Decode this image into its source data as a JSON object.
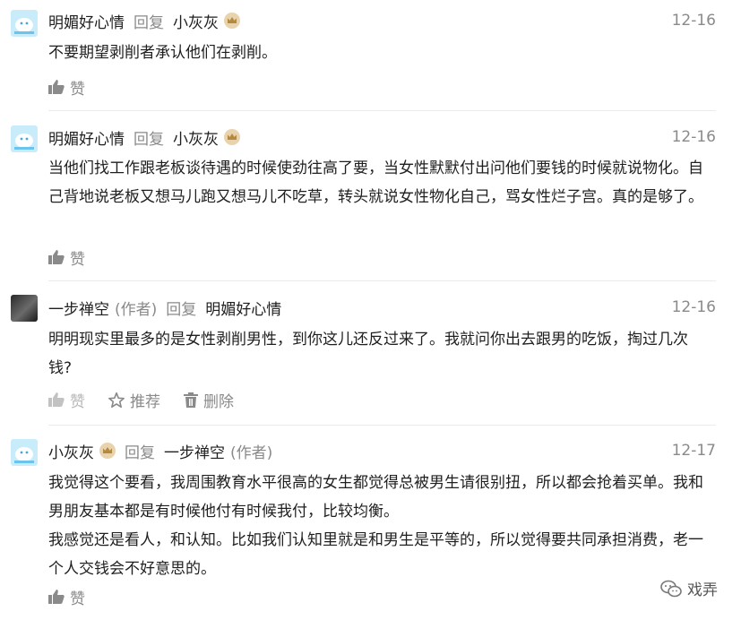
{
  "comments": [
    {
      "author": "明媚好心情",
      "author_tag": "",
      "reply_label": "回复",
      "reply_to": "小灰灰",
      "reply_to_tag": "",
      "date": "12-16",
      "text": "不要期望剥削者承认他们在剥削。",
      "actions": [
        "赞"
      ]
    },
    {
      "author": "明媚好心情",
      "author_tag": "",
      "reply_label": "回复",
      "reply_to": "小灰灰",
      "reply_to_tag": "",
      "date": "12-16",
      "text": "当他们找工作跟老板谈待遇的时候使劲往高了要，当女性默默付出问他们要钱的时候就说物化。自己背地说老板又想马儿跑又想马儿不吃草，转头就说女性物化自己，骂女性烂子宫。真的是够了。",
      "actions": [
        "赞"
      ]
    },
    {
      "author": "一步禅空",
      "author_tag": "(作者)",
      "reply_label": "回复",
      "reply_to": "明媚好心情",
      "reply_to_tag": "",
      "date": "12-16",
      "text": "明明现实里最多的是女性剥削男性，到你这儿还反过来了。我就问你出去跟男的吃饭，掏过几次钱?",
      "actions": [
        "赞",
        "推荐",
        "删除"
      ]
    },
    {
      "author": "小灰灰",
      "author_tag": "",
      "reply_label": "回复",
      "reply_to": "一步禅空",
      "reply_to_tag": "(作者)",
      "date": "12-17",
      "text": "我觉得这个要看，我周围教育水平很高的女生都觉得总被男生请很别扭，所以都会抢着买单。我和男朋友基本都是有时候他付有时候我付，比较均衡。",
      "text2": "我感觉还是看人，和认知。比如我们认知里就是和男生是平等的，所以觉得要共同承担消费，老一个人交钱会不好意思的。",
      "actions": [
        "赞"
      ]
    }
  ],
  "watermark": "戏弄",
  "colors": {
    "text": "#1f1f1f",
    "muted": "#8a8a8a",
    "badge": "#e8d3ad",
    "avatar_blue": "#c9ecfb"
  }
}
